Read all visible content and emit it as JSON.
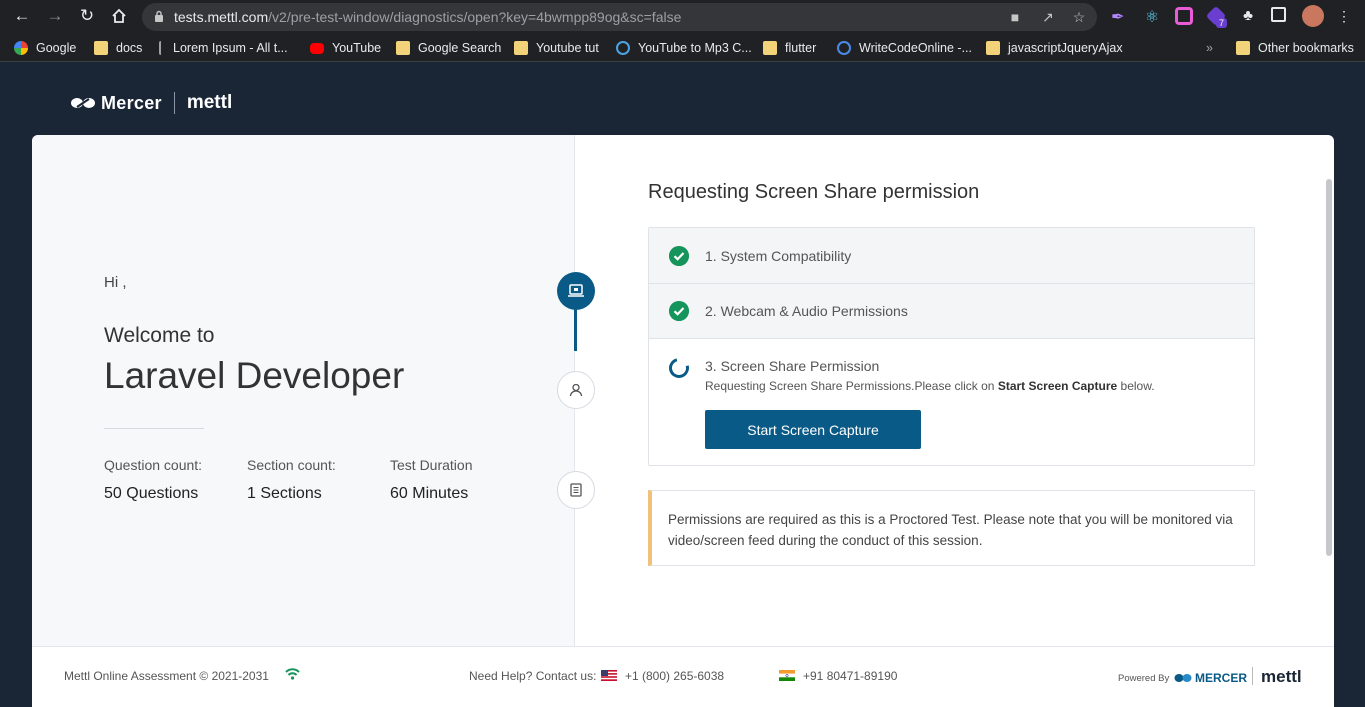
{
  "browser": {
    "url_host": "tests.mettl.com",
    "url_path": "/v2/pre-test-window/diagnostics/open?key=4bwmpp89og&sc=false",
    "extension_badge": "7",
    "bookmarks": [
      {
        "label": "Google",
        "icon": "google-icon"
      },
      {
        "label": "docs",
        "icon": "folder-icon"
      },
      {
        "label": "Lorem Ipsum - All t...",
        "icon": "page-icon"
      },
      {
        "label": "YouTube",
        "icon": "youtube-icon"
      },
      {
        "label": "Google Search",
        "icon": "folder-icon"
      },
      {
        "label": "Youtube tut",
        "icon": "folder-icon"
      },
      {
        "label": "YouTube to Mp3 C...",
        "icon": "download-icon"
      },
      {
        "label": "flutter",
        "icon": "folder-icon"
      },
      {
        "label": "WriteCodeOnline -...",
        "icon": "code-icon"
      },
      {
        "label": "javascriptJqueryAjax",
        "icon": "folder-icon"
      }
    ],
    "other_bookmarks": "Other bookmarks"
  },
  "brand": {
    "mercer": "Mercer",
    "mettl": "mettl"
  },
  "left": {
    "greeting": "Hi ,",
    "welcome": "Welcome to",
    "test_name": "Laravel Developer",
    "stats": [
      {
        "label": "Question count:",
        "value": "50 Questions"
      },
      {
        "label": "Section count:",
        "value": "1 Sections"
      },
      {
        "label": "Test Duration",
        "value": "60  Minutes"
      }
    ]
  },
  "right": {
    "title": "Requesting Screen Share permission",
    "steps": [
      {
        "label": "1. System Compatibility",
        "status": "done"
      },
      {
        "label": "2. Webcam & Audio Permissions",
        "status": "done"
      },
      {
        "label": "3. Screen Share Permission",
        "status": "in-progress"
      }
    ],
    "step3_sub_prefix": "Requesting Screen Share Permissions.Please click on ",
    "step3_sub_bold": "Start Screen Capture",
    "step3_sub_suffix": " below.",
    "capture_button": "Start Screen Capture",
    "notice": "Permissions are required as this is a Proctored Test. Please note that you will be monitored via video/screen feed during the conduct of this session."
  },
  "footer": {
    "copyright": "Mettl Online Assessment © 2021-2031",
    "help": "Need Help? Contact us:",
    "phone_us": "+1 (800) 265-6038",
    "phone_in": "+91 80471-89190",
    "powered_by": "Powered By",
    "mercer": "MERCER",
    "mettl": "mettl"
  },
  "colors": {
    "accent": "#0a5a87",
    "success": "#15945c",
    "page_bg": "#1a2535",
    "notice_border": "#f0c17a"
  }
}
